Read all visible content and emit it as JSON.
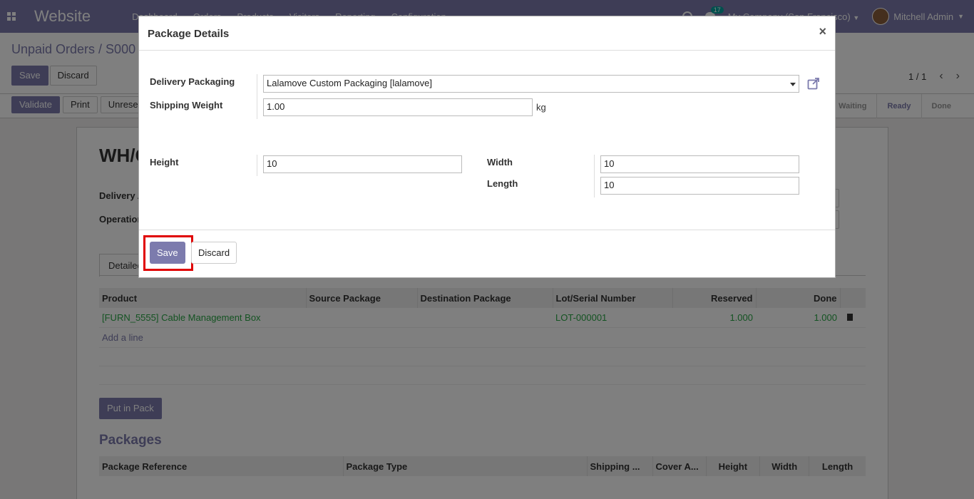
{
  "navbar": {
    "brand": "Website",
    "menu": [
      "Dashboard",
      "Orders",
      "Products",
      "Visitors",
      "Reporting",
      "Configuration"
    ],
    "chat_count": "17",
    "company": "My Company (San Francisco)",
    "user": "Mitchell Admin"
  },
  "control": {
    "breadcrumb": "Unpaid Orders / S000",
    "save_label": "Save",
    "discard_label": "Discard",
    "pager": "1 / 1"
  },
  "statusbar": {
    "buttons": [
      "Validate",
      "Print",
      "Unreserve"
    ],
    "stages": [
      "Waiting",
      "Ready",
      "Done"
    ],
    "active_stage": "Ready"
  },
  "sheet": {
    "title": "WH/O",
    "labels": [
      "Delivery A",
      "Operation"
    ],
    "tab": "Detailed",
    "ops_headers": [
      "Product",
      "Source Package",
      "Destination Package",
      "Lot/Serial Number",
      "Reserved",
      "Done"
    ],
    "ops_rows": [
      {
        "product": "[FURN_5555] Cable Management Box",
        "lot": "LOT-000001",
        "reserved": "1.000",
        "done": "1.000"
      }
    ],
    "add_line": "Add a line",
    "put_in_pack": "Put in Pack",
    "packages_title": "Packages",
    "pkg_headers": [
      "Package Reference",
      "Package Type",
      "Shipping ...",
      "Cover A...",
      "Height",
      "Width",
      "Length"
    ]
  },
  "modal": {
    "title": "Package Details",
    "close": "×",
    "delivery_packaging_label": "Delivery Packaging",
    "delivery_packaging_value": "Lalamove Custom Packaging [lalamove]",
    "shipping_weight_label": "Shipping Weight",
    "shipping_weight_value": "1.00",
    "weight_unit": "kg",
    "height_label": "Height",
    "height_value": "10",
    "width_label": "Width",
    "width_value": "10",
    "length_label": "Length",
    "length_value": "10",
    "save_label": "Save",
    "discard_label": "Discard"
  },
  "colors": {
    "brand": "#7c7bad",
    "highlight": "#e00000",
    "link_green": "#28a745"
  }
}
